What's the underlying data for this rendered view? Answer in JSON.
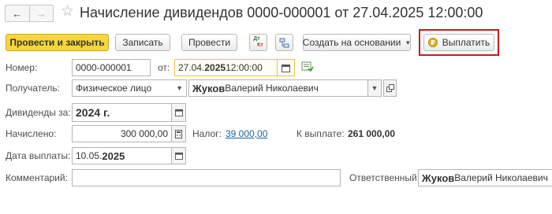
{
  "window": {
    "title": "Начисление дивидендов 0000-000001 от 27.04.2025 12:00:00"
  },
  "nav": {
    "back_icon": "←",
    "forward_icon": "→",
    "favorite_icon": "☆"
  },
  "toolbar": {
    "post_and_close": "Провести и закрыть",
    "save": "Записать",
    "post": "Провести",
    "dtkt_dt": "Дт",
    "dtkt_kt": "Кт",
    "create_based_on": "Создать на основании",
    "pay": "Выплатить",
    "pay_coin": "₽",
    "highlight_color": "#c8191e",
    "primary_color": "#f8d53a"
  },
  "form": {
    "number_label": "Номер:",
    "number_value": "0000-000001",
    "from_label": "от:",
    "date_prefix": "27.04.",
    "date_year": "2025",
    "date_time": " 12:00:00",
    "recipient_label": "Получатель:",
    "recipient_type": "Физическое лицо",
    "recipient_name_bold": "Жуков",
    "recipient_name_rest": " Валерий Николаевич",
    "dividends_for_label": "Дивиденды за:",
    "dividends_for_value": "2024 г.",
    "accrued_label": "Начислено:",
    "accrued_value": "300 000,00",
    "tax_label": "Налог:",
    "tax_value": "39 000,00",
    "to_pay_label": "К выплате:",
    "to_pay_value": "261 000,00",
    "payment_date_label": "Дата выплаты:",
    "payment_date_prefix": "10.05.",
    "payment_date_year": "2025",
    "comment_label": "Комментарий:",
    "comment_value": "",
    "responsible_label": "Ответственный:",
    "responsible_bold": "Жуков",
    "responsible_rest": " Валерий Николаевич"
  }
}
